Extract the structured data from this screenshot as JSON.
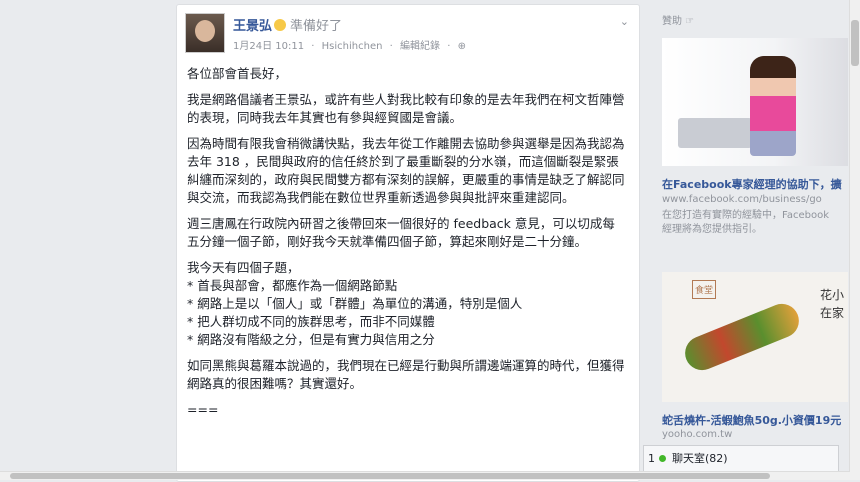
{
  "post": {
    "author": "王景弘",
    "feeling": "準備好了",
    "date": "1月24日 10:11",
    "separator": "·",
    "tagged": "Hsichihchen",
    "edit_history": "編輯紀錄",
    "privacy_icon": "globe-icon",
    "menu_icon": "chevron-down-icon",
    "paragraphs": [
      "各位部會首長好，",
      "我是網路倡議者王景弘，或許有些人對我比較有印象的是去年我們在柯文哲陣營的表現，同時我去年其實也有參與經貿國是會議。",
      "因為時間有限我會稍微講快點，我去年從工作離開去協助參與選舉是因為我認為去年 318 ，民間與政府的信任終於到了最重斷裂的分水嶺，而這個斷裂是緊張 糾纏而深刻的，政府與民間雙方都有深刻的誤解，更嚴重的事情是缺乏了解認同與交流，而我認為我們能在數位世界重新透過參與與批評來重建認同。",
      "週三唐鳳在行政院內研習之後帶回來一個很好的 feedback 意見，可以切成每五分鐘一個子節，剛好我今天就準備四個子節，算起來剛好是二十分鐘。"
    ],
    "list_intro": "我今天有四個子題，",
    "list_items": [
      "* 首長與部會，都應作為一個網路節點",
      "* 網路上是以「個人」或「群體」為單位的溝通，特別是個人",
      "* 把人群切成不同的族群思考，而非不同媒體",
      "* 網路沒有階級之分，但是有實力與信用之分"
    ],
    "closing": "如同黑熊與葛羅本說過的，我們現在已經是行動與所謂邊端運算的時代，但獲得網路真的很困難嗎？其實還好。",
    "divider": "==="
  },
  "sidebar": {
    "title": "贊助 ☞",
    "ad1": {
      "headline": "在Facebook專家經理的協助下，擴",
      "url": "www.facebook.com/business/go",
      "desc1": "在您打造有實際的經驗中，Facebook",
      "desc2": "經理將為您提供指引。"
    },
    "ad2": {
      "badge": "食堂",
      "image_text": "花小\n在家",
      "headline": "蛇舌燒杵-活蝦鮑魚50g.小資價19元",
      "url": "yooho.com.tw"
    }
  },
  "chat": {
    "label": "聊天室(82)",
    "count_prefix": "1"
  }
}
